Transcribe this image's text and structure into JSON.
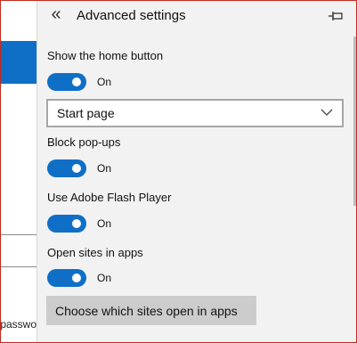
{
  "background_page": {
    "partial_text": "passwo"
  },
  "pane": {
    "title": "Advanced settings",
    "back_icon": "double-chevron-left-icon",
    "pin_icon": "pin-icon"
  },
  "settings": {
    "home_button": {
      "label": "Show the home button",
      "state": "On"
    },
    "home_page_select": {
      "value": "Start page"
    },
    "popups": {
      "label": "Block pop-ups",
      "state": "On"
    },
    "flash": {
      "label": "Use Adobe Flash Player",
      "state": "On"
    },
    "open_in_apps": {
      "label": "Open sites in apps",
      "state": "On"
    },
    "choose_sites_button": "Choose which sites open in apps"
  },
  "colors": {
    "accent": "#0f6fc6",
    "pane_bg": "#f2f2f2",
    "button_bg": "#cccccc",
    "window_border": "#c42b1c"
  }
}
